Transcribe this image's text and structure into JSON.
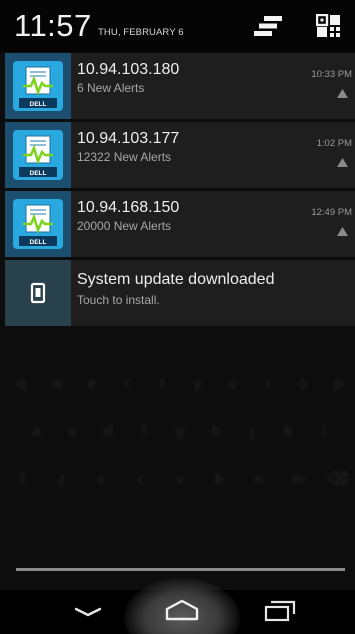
{
  "status": {
    "time": "11:57",
    "date": "THU, FEBRUARY 6",
    "settings_icon": "quick-settings-icon",
    "grid_icon": "quick-settings-grid-icon"
  },
  "notifications": [
    {
      "icon": "dell-alerts-icon",
      "icon_label": "DELL",
      "title": "10.94.103.180",
      "subtitle": "6 New Alerts",
      "time": "10:33 PM",
      "small_icon": "alert-triangle-icon"
    },
    {
      "icon": "dell-alerts-icon",
      "icon_label": "DELL",
      "title": "10.94.103.177",
      "subtitle": "12322 New Alerts",
      "time": "1:02 PM",
      "small_icon": "alert-triangle-icon"
    },
    {
      "icon": "dell-alerts-icon",
      "icon_label": "DELL",
      "title": "10.94.168.150",
      "subtitle": "20000 New Alerts",
      "time": "12:49 PM",
      "small_icon": "alert-triangle-icon"
    },
    {
      "icon": "system-update-icon",
      "title": "System update downloaded",
      "subtitle": "Touch to install."
    }
  ],
  "navbar": {
    "back_icon": "back-chevron-icon",
    "home_icon": "home-icon",
    "recents_icon": "recent-apps-icon"
  },
  "colors": {
    "background": "#0d0d0d",
    "notification_bg": "#1e1e1e",
    "app_icon_bg": "#1c4e70",
    "app_icon_accent": "#2aa8e0",
    "app_icon_green": "#7ed321",
    "text_primary": "#eeeeee",
    "text_secondary": "#a7a7a7"
  }
}
